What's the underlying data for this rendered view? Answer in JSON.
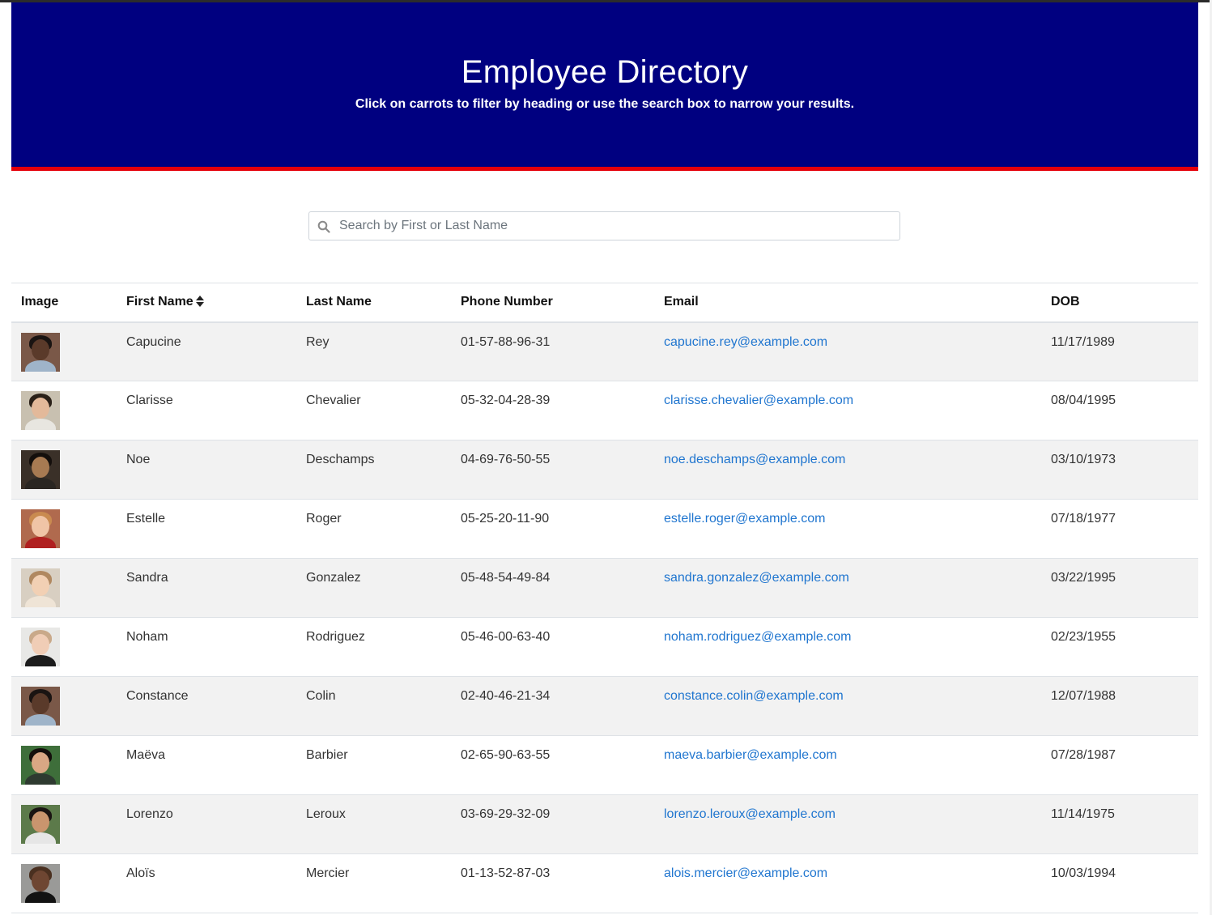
{
  "header": {
    "title": "Employee Directory",
    "subtitle": "Click on carrots to filter by heading or use the search box to narrow your results."
  },
  "search": {
    "placeholder": "Search by First or Last Name",
    "icon": "search-icon"
  },
  "table": {
    "columns": {
      "image": "Image",
      "first_name": "First Name",
      "last_name": "Last Name",
      "phone": "Phone Number",
      "email": "Email",
      "dob": "DOB"
    },
    "rows": [
      {
        "first": "Capucine",
        "last": "Rey",
        "phone": "01-57-88-96-31",
        "email": "capucine.rey@example.com",
        "dob": "11/17/1989"
      },
      {
        "first": "Clarisse",
        "last": "Chevalier",
        "phone": "05-32-04-28-39",
        "email": "clarisse.chevalier@example.com",
        "dob": "08/04/1995"
      },
      {
        "first": "Noe",
        "last": "Deschamps",
        "phone": "04-69-76-50-55",
        "email": "noe.deschamps@example.com",
        "dob": "03/10/1973"
      },
      {
        "first": "Estelle",
        "last": "Roger",
        "phone": "05-25-20-11-90",
        "email": "estelle.roger@example.com",
        "dob": "07/18/1977"
      },
      {
        "first": "Sandra",
        "last": "Gonzalez",
        "phone": "05-48-54-49-84",
        "email": "sandra.gonzalez@example.com",
        "dob": "03/22/1995"
      },
      {
        "first": "Noham",
        "last": "Rodriguez",
        "phone": "05-46-00-63-40",
        "email": "noham.rodriguez@example.com",
        "dob": "02/23/1955"
      },
      {
        "first": "Constance",
        "last": "Colin",
        "phone": "02-40-46-21-34",
        "email": "constance.colin@example.com",
        "dob": "12/07/1988"
      },
      {
        "first": "Maëva",
        "last": "Barbier",
        "phone": "02-65-90-63-55",
        "email": "maeva.barbier@example.com",
        "dob": "07/28/1987"
      },
      {
        "first": "Lorenzo",
        "last": "Leroux",
        "phone": "03-69-29-32-09",
        "email": "lorenzo.leroux@example.com",
        "dob": "11/14/1975"
      },
      {
        "first": "Aloïs",
        "last": "Mercier",
        "phone": "01-13-52-87-03",
        "email": "alois.mercier@example.com",
        "dob": "10/03/1994"
      }
    ]
  },
  "colors": {
    "header_bg": "#000080",
    "header_border": "#e5000a",
    "link": "#1f75cf",
    "stripe": "#f2f2f2"
  }
}
